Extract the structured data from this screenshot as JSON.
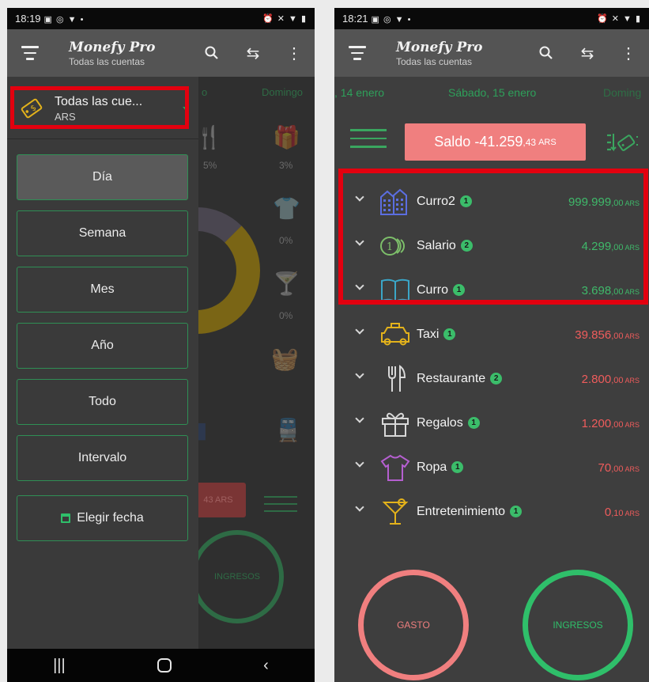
{
  "left": {
    "status": {
      "time": "18:19"
    },
    "appbar": {
      "title": "Monefy Pro",
      "subtitle": "Todas las cuentas"
    },
    "drawer": {
      "account_name": "Todas las cue...",
      "account_currency": "ARS",
      "periods": [
        "Día",
        "Semana",
        "Mes",
        "Año",
        "Todo",
        "Intervalo"
      ],
      "choose_date": "Elegir fecha",
      "active_period": "Día"
    },
    "background": {
      "date_partial": "o",
      "date_next": "Domingo",
      "pct_1": "5%",
      "pct_2": "3%",
      "pct_3": "0%",
      "pct_4": "0%",
      "balance_partial": "43 ARS",
      "ingresos": "INGRESOS"
    }
  },
  "right": {
    "status": {
      "time": "18:21"
    },
    "appbar": {
      "title": "Monefy Pro",
      "subtitle": "Todas las cuentas"
    },
    "dates": {
      "prev": ", 14 enero",
      "current": "Sábado, 15 enero",
      "next": "Doming"
    },
    "balance": {
      "label": "Saldo",
      "int": "-41.259",
      "dec": ",43",
      "currency": "ARS"
    },
    "categories": [
      {
        "name": "Curro2",
        "count": "1",
        "int": "999.999",
        "dec": ",00",
        "currency": "ARS",
        "type": "income",
        "icon": "buildings-icon"
      },
      {
        "name": "Salario",
        "count": "2",
        "int": "4.299",
        "dec": ",00",
        "currency": "ARS",
        "type": "income",
        "icon": "coins-icon"
      },
      {
        "name": "Curro",
        "count": "1",
        "int": "3.698",
        "dec": ",00",
        "currency": "ARS",
        "type": "income",
        "icon": "book-icon"
      },
      {
        "name": "Taxi",
        "count": "1",
        "int": "39.856",
        "dec": ",00",
        "currency": "ARS",
        "type": "expense",
        "icon": "taxi-icon"
      },
      {
        "name": "Restaurante",
        "count": "2",
        "int": "2.800",
        "dec": ",00",
        "currency": "ARS",
        "type": "expense",
        "icon": "cutlery-icon"
      },
      {
        "name": "Regalos",
        "count": "1",
        "int": "1.200",
        "dec": ",00",
        "currency": "ARS",
        "type": "expense",
        "icon": "gift-icon"
      },
      {
        "name": "Ropa",
        "count": "1",
        "int": "70",
        "dec": ",00",
        "currency": "ARS",
        "type": "expense",
        "icon": "shirt-icon"
      },
      {
        "name": "Entretenimiento",
        "count": "1",
        "int": "0",
        "dec": ",10",
        "currency": "ARS",
        "type": "expense",
        "icon": "cocktail-icon"
      }
    ],
    "buttons": {
      "expense": "GASTO",
      "income": "INGRESOS"
    }
  },
  "colors": {
    "income": "#3fb96a",
    "expense": "#ef5c5c",
    "highlight": "#e3000f",
    "saldo_bg": "#f07f7f"
  }
}
